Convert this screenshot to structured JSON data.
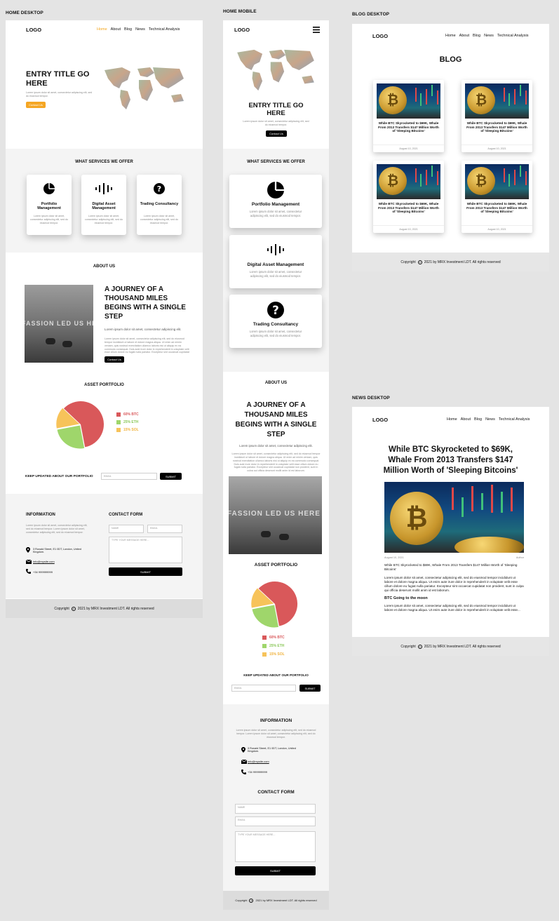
{
  "labels": {
    "home_desktop": "HOME DESKTOP",
    "home_mobile": "HOME MOBILE",
    "blog_desktop": "BLOG DESKTOP",
    "news_desktop": "NEWS DESKTOP"
  },
  "brand": {
    "logo": "LOGO",
    "accent": "#f5a623"
  },
  "nav": {
    "home": "Home",
    "about": "About",
    "blog": "Blog",
    "news": "News",
    "ta": "Technical Analysis"
  },
  "hero": {
    "title": "ENTRY TITLE GO HERE",
    "text": "Lorem ipsum dolor sit amet, consectetur adipiscing elit, sed do eiusmod tempor.",
    "cta": "Contact Us",
    "cta_mobile": "Contact Us"
  },
  "services": {
    "heading": "WHAT SERVICES WE OFFER",
    "items": [
      {
        "title": "Portfolio Management",
        "icon": "pie-chart-icon",
        "text": "Lorem ipsum dolor sit amet, consectetur adipiscing elit, sed do eiusmod tempor."
      },
      {
        "title": "Digital Asset Management",
        "icon": "sound-wave-icon",
        "text": "Lorem ipsum dolor sit amet, consectetur adipiscing elit, sed do eiusmod tempor."
      },
      {
        "title": "Trading Consultancy",
        "icon": "question-icon",
        "text": "Lorem ipsum dolor sit amet, consectetur adipiscing elit, sed do eiusmod tempor."
      }
    ]
  },
  "about": {
    "heading": "ABOUT US",
    "title": "A JOURNEY OF A THOUSAND MILES BEGINS WITH A SINGLE STEP",
    "lead": "Lorem ipsum dolor sit amet, consectetur adipiscing elit.",
    "body": "Lorem ipsum dolor sit amet, consectetur adipiscing elit, sed do eiusmod tempor incididunt ut labore et dolore magna aliqua. Ut enim ad minim veniam, quis nostrud exercitation ullamco laboris nisi ut aliquip ex ea commodo consequat. Duis aute irure dolor in reprehenderit in voluptate velit esse cillum dolore eu fugiat nulla pariatur. Excepteur sint occaecat cupidatat non proident, sunt in culpa qui officia deserunt mollit anim id est laborum.",
    "cta": "Contact Us",
    "image_text": "FASSION LED US HERE"
  },
  "portfolio": {
    "heading": "ASSET PORTFOLIO",
    "legend": [
      {
        "label": "60% BTC",
        "color": "#d9585a"
      },
      {
        "label": "25% ETH",
        "color": "#9fd66b"
      },
      {
        "label": "15% SOL",
        "color": "#f7c35a"
      }
    ]
  },
  "chart_data": {
    "type": "pie",
    "categories": [
      "BTC",
      "ETH",
      "SOL"
    ],
    "values": [
      60,
      25,
      15
    ],
    "colors": [
      "#d9585a",
      "#9fd66b",
      "#f7c35a"
    ]
  },
  "newsletter": {
    "label": "KEEP UPDATED ABOUT OUR PORTFOLIO",
    "placeholder": "EMAIL",
    "button": "SUBMIT"
  },
  "info": {
    "heading": "INFORMATION",
    "text": "Lorem ipsum dolor sit amet, consectetur adipiscing elit, sed do eiusmod tempor. Lorem ipsum dolor sit amet, consectetur adipiscing elit, sed do eiusmod tempor.",
    "address": "3 Ronald Street, E1 0DT, London, United Kingdom.",
    "email": "info@mysite.com",
    "phone": "+34 999999999"
  },
  "contact": {
    "heading": "CONTACT FORM",
    "name": "NAME",
    "email": "EMAIL",
    "message": "TYPE YOUR MESSAGE HERE...",
    "submit": "SUBMIT"
  },
  "footer": {
    "copyright": "Copyright",
    "text": "2021 by MRX Investment LDT. All rights reserved"
  },
  "blog": {
    "heading": "BLOG",
    "posts": [
      {
        "title": "While BTC Skyrocketed to $69K, Whale From 2013 Transfers $147 Million Worth of 'Sleeping Bitcoins'",
        "date": "August 10, 2021"
      },
      {
        "title": "While BTC Skyrocketed to $69K, Whale From 2013 Transfers $147 Million Worth of 'Sleeping Bitcoins'",
        "date": "August 10, 2021"
      },
      {
        "title": "While BTC Skyrocketed to $69K, Whale From 2013 Transfers $147 Million Worth of 'Sleeping Bitcoins'",
        "date": "August 10, 2021"
      },
      {
        "title": "While BTC Skyrocketed to $69K, Whale From 2013 Transfers $147 Million Worth of 'Sleeping Bitcoins'",
        "date": "August 10, 2021"
      }
    ]
  },
  "news": {
    "title": "While BTC Skyrocketed to $69K, Whale From 2013 Transfers $147 Million Worth of 'Sleeping Bitcoins'",
    "date": "August 10, 2021",
    "author": "Author",
    "caption": "While BTC Skyrocketed to $69K, Whale From 2013 Transfers $147 Million Worth of 'Sleeping Bitcoins'",
    "p1": "Lorem ipsum dolor sit amet, consectetur adipiscing elit, sed do eiusmod tempor incididunt ut labore et dolore magna aliqua. Ut enim aute irure dolor in reprehenderit in voluptate velit esse cillum dolore eu fugiat nulla pariatur. Excepteur sint occaecat cupidatat non proident, sunt in culpa qui officia deserunt mollit anim id est laborum.",
    "sub": "BTC Going to the moon",
    "p2": "Lorem ipsum dolor sit amet, consectetur adipiscing elit, sed do eiusmod tempor incididunt ut labore et dolore magna aliqua. Ut enim aute irure dolor in reprehenderit in voluptate velit esse..."
  }
}
